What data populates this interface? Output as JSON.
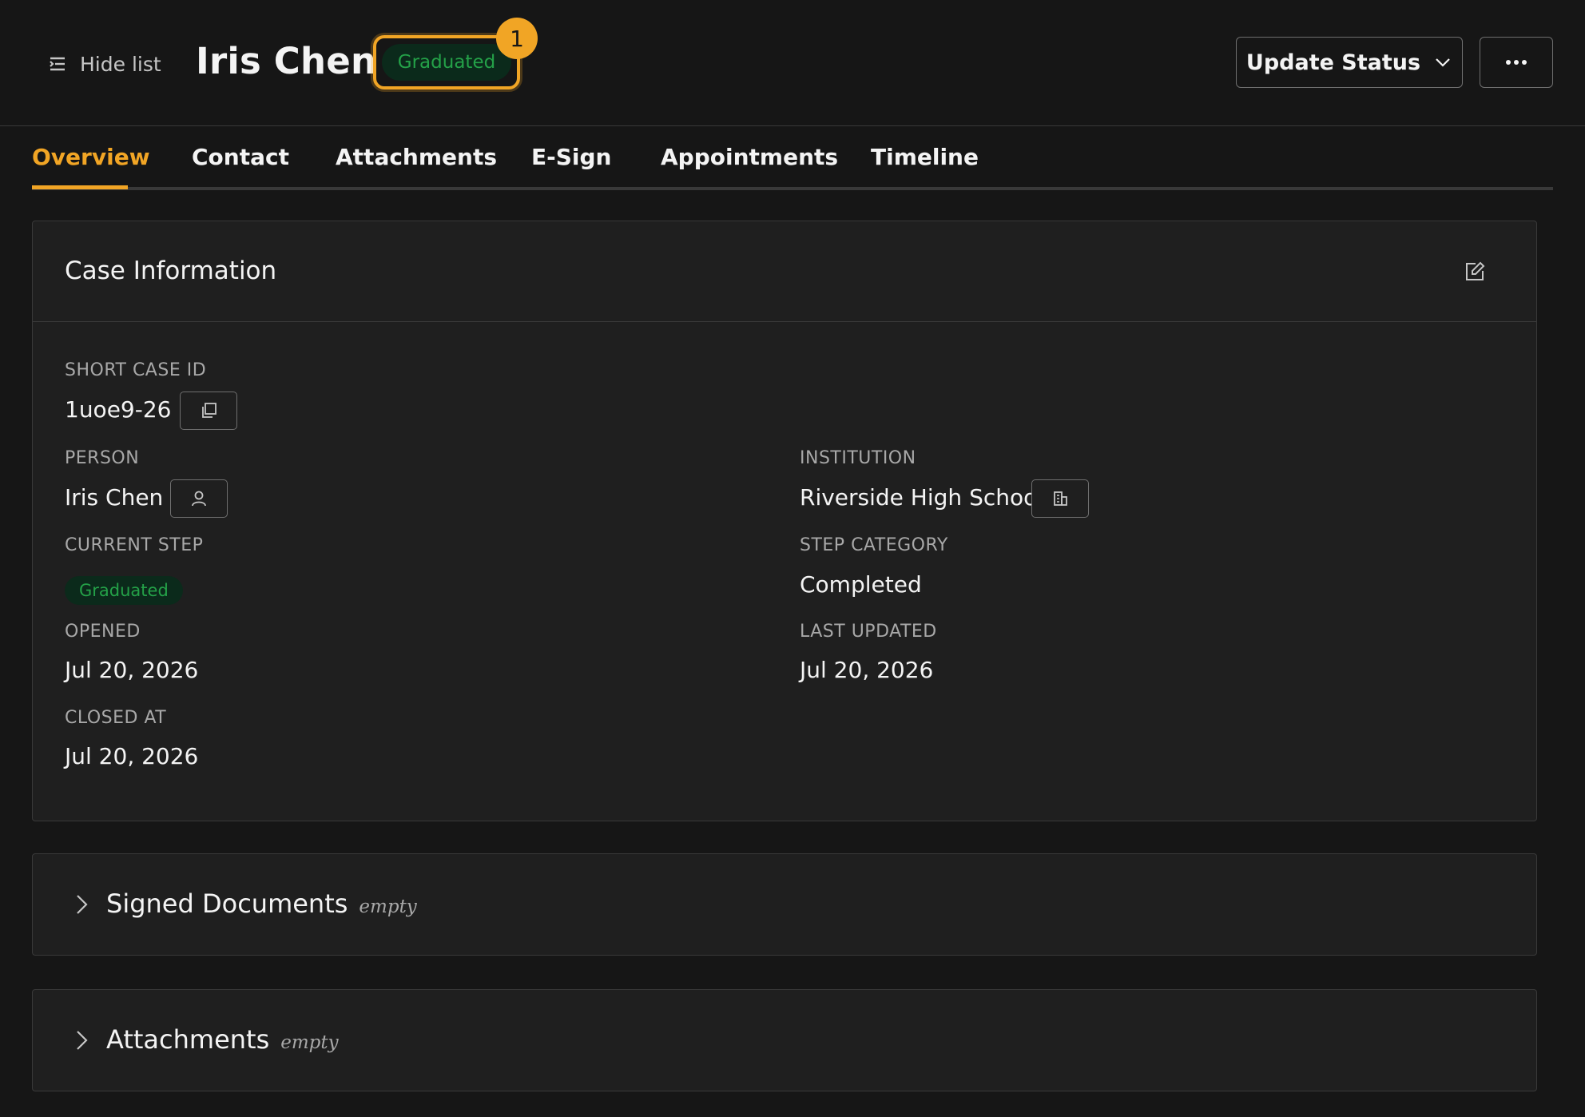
{
  "header": {
    "hide_list_label": "Hide list",
    "title": "Iris Chen",
    "status_tag": "Graduated",
    "notification_count": "1",
    "update_status_label": "Update Status"
  },
  "tabs": [
    {
      "label": "Overview",
      "active": true
    },
    {
      "label": "Contact",
      "active": false
    },
    {
      "label": "Attachments",
      "active": false
    },
    {
      "label": "E-Sign",
      "active": false
    },
    {
      "label": "Appointments",
      "active": false
    },
    {
      "label": "Timeline",
      "active": false
    }
  ],
  "case_info": {
    "title": "Case Information",
    "short_case_id_label": "SHORT CASE ID",
    "short_case_id": "1uoe9-26",
    "person_label": "PERSON",
    "person": "Iris Chen",
    "institution_label": "INSTITUTION",
    "institution": "Riverside High School",
    "current_step_label": "CURRENT STEP",
    "current_step": "Graduated",
    "step_category_label": "STEP CATEGORY",
    "step_category": "Completed",
    "opened_label": "OPENED",
    "opened": "Jul 20, 2026",
    "last_updated_label": "LAST UPDATED",
    "last_updated": "Jul 20, 2026",
    "closed_at_label": "CLOSED AT",
    "closed_at": "Jul 20, 2026"
  },
  "sections": [
    {
      "title": "Signed Documents",
      "meta": "empty"
    },
    {
      "title": "Attachments",
      "meta": "empty"
    }
  ],
  "colors": {
    "accent": "#f1a525",
    "success_text": "#24a148",
    "success_bg": "#0b2a1b",
    "background": "#161616",
    "card": "#1f1f1f"
  },
  "icons": {
    "hide_list": "list-indent-icon",
    "update_status": "chevron-down-icon",
    "more": "overflow-menu-icon",
    "edit": "edit-icon",
    "copy": "copy-icon",
    "person": "user-icon",
    "institution": "building-icon",
    "expand": "chevron-right-icon"
  }
}
